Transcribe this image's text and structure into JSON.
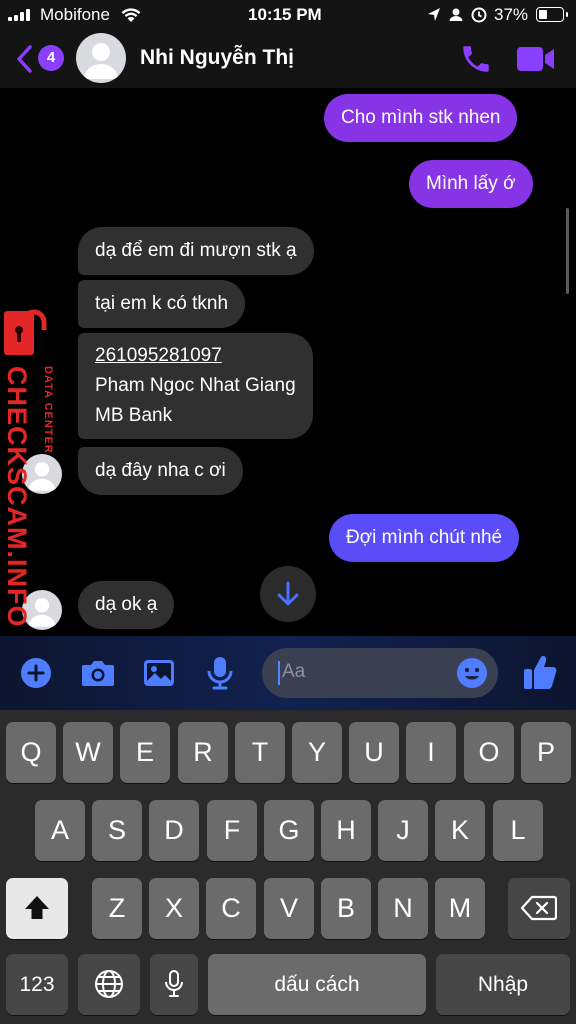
{
  "status_bar": {
    "carrier": "Mobifone",
    "time": "10:15 PM",
    "battery": "37%",
    "battery_level": 0.37
  },
  "header": {
    "back_badge": "4",
    "contact_name": "Nhi Nguyễn Thị"
  },
  "messages": [
    {
      "from": "me",
      "lines": [
        "Cho mình stk nhen"
      ]
    },
    {
      "from": "me",
      "lines": [
        "Mình lấy ớ"
      ]
    },
    {
      "from": "them",
      "lines": [
        "dạ để em đi mượn stk ạ"
      ]
    },
    {
      "from": "them",
      "lines": [
        "tại em k có tknh"
      ]
    },
    {
      "from": "them",
      "lines": [
        "261095281097",
        "Pham Ngoc Nhat Giang",
        "MB Bank"
      ]
    },
    {
      "from": "them",
      "lines": [
        "dạ đây nha c ơi"
      ]
    },
    {
      "from": "me",
      "lines": [
        "Đợi mình chút nhé"
      ]
    },
    {
      "from": "them",
      "lines": [
        "dạ ok ạ"
      ]
    }
  ],
  "watermark": {
    "main": "CHECKSCAM.INFO",
    "sub": "DATA CENTER"
  },
  "composer": {
    "placeholder": "Aa"
  },
  "keyboard": {
    "row1": [
      "Q",
      "W",
      "E",
      "R",
      "T",
      "Y",
      "U",
      "I",
      "O",
      "P"
    ],
    "row2": [
      "A",
      "S",
      "D",
      "F",
      "G",
      "H",
      "J",
      "K",
      "L"
    ],
    "row3": [
      "Z",
      "X",
      "C",
      "V",
      "B",
      "N",
      "M"
    ],
    "numbers_key": "123",
    "space_key": "dấu cách",
    "return_key": "Nhập"
  },
  "colors": {
    "accent": "#8a3ffc",
    "outgoing_bubble": "#8734e6",
    "incoming_bubble": "#303030",
    "watermark_red": "#e32626"
  },
  "icons": [
    "back-chevron-icon",
    "phone-icon",
    "video-camera-icon",
    "plus-icon",
    "camera-icon",
    "image-icon",
    "microphone-icon",
    "emoji-icon",
    "thumbs-up-icon",
    "arrow-down-icon",
    "shift-icon",
    "backspace-icon",
    "globe-icon",
    "lock-icon",
    "wifi-icon",
    "location-icon",
    "person-icon",
    "alarm-icon"
  ]
}
